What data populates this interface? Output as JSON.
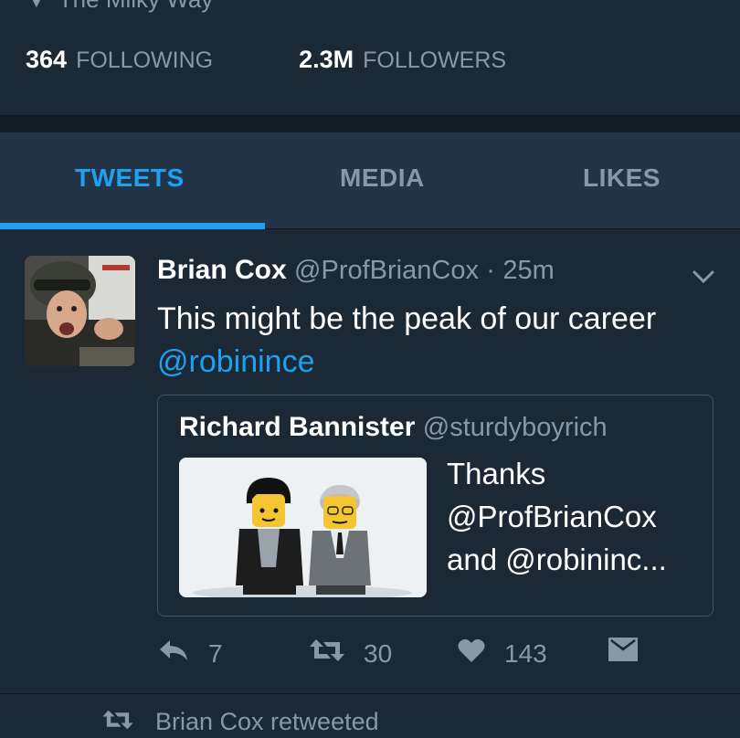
{
  "profile": {
    "location": "The Milky Way",
    "following_count": "364",
    "following_label": "FOLLOWING",
    "followers_count": "2.3M",
    "followers_label": "FOLLOWERS"
  },
  "tabs": [
    {
      "label": "TWEETS",
      "active": true
    },
    {
      "label": "MEDIA",
      "active": false
    },
    {
      "label": "LIKES",
      "active": false
    }
  ],
  "tweet": {
    "author_name": "Brian Cox",
    "author_handle": "@ProfBrianCox",
    "separator": "·",
    "time": "25m",
    "text": "This might be the peak of our career",
    "mention": "@robinince",
    "quote": {
      "author_name": "Richard Bannister",
      "author_handle": "@sturdyboyrich",
      "text": "Thanks @ProfBrianCox and @robininc..."
    },
    "actions": {
      "reply_count": "7",
      "retweet_count": "30",
      "like_count": "143"
    }
  },
  "next_item": {
    "retweet_notice": "Brian Cox retweeted"
  },
  "colors": {
    "background": "#1b2836",
    "accent": "#1da1f2",
    "muted": "#8899a6"
  }
}
